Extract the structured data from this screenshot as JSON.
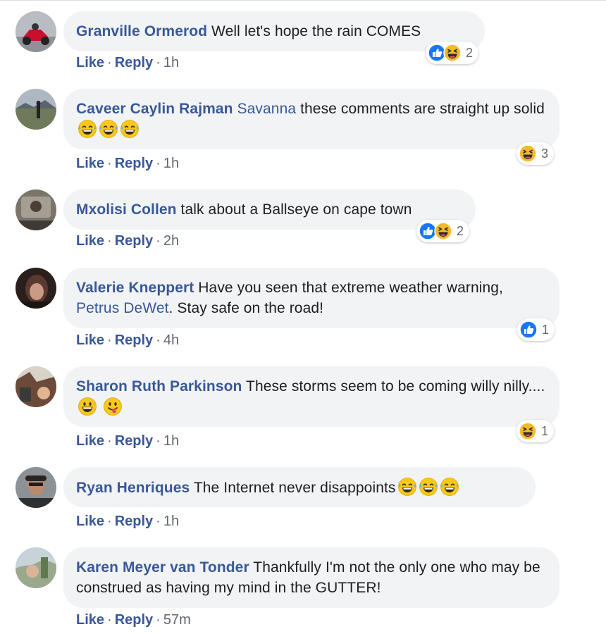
{
  "actions": {
    "like_label": "Like",
    "reply_label": "Reply",
    "separator": "·"
  },
  "colors": {
    "link": "#385898",
    "bubble": "#f2f3f5",
    "like_blue": "#1877f2",
    "haha_yellow": "#f7b928"
  },
  "comments": [
    {
      "author": "Granville Ormerod",
      "mention": "",
      "text": "Well let's hope the rain COMES",
      "text2": "",
      "time": "1h",
      "reaction_icons": [
        "like-icon",
        "haha-icon"
      ],
      "reaction_count": "2"
    },
    {
      "author": "Caveer Caylin Rajman",
      "mention": "Savanna",
      "text": "these comments are straight up solid",
      "text2": "",
      "time": "1h",
      "trailing_emojis": [
        "grinning-sweat-emoji",
        "grinning-sweat-emoji",
        "grinning-sweat-emoji"
      ],
      "reaction_icons": [
        "haha-icon"
      ],
      "reaction_count": "3"
    },
    {
      "author": "Mxolisi Collen",
      "mention": "",
      "text": "talk about a Ballseye on cape town",
      "text2": "",
      "time": "2h",
      "reaction_icons": [
        "like-icon",
        "haha-icon"
      ],
      "reaction_count": "2"
    },
    {
      "author": "Valerie Kneppert",
      "mention": "Petrus DeWet",
      "text": "Have you seen that extreme weather warning,",
      "text2": ". Stay safe on the road!",
      "time": "4h",
      "reaction_icons": [
        "like-icon"
      ],
      "reaction_count": "1"
    },
    {
      "author": "Sharon Ruth Parkinson",
      "mention": "",
      "text": "These storms seem to be coming willy nilly....",
      "text2": "",
      "time": "1h",
      "trailing_emojis": [
        "grinning-emoji",
        "tongue-emoji"
      ],
      "reaction_icons": [
        "haha-icon"
      ],
      "reaction_count": "1"
    },
    {
      "author": "Ryan Henriques",
      "mention": "",
      "text": "The Internet never disappoints",
      "text2": "",
      "time": "1h",
      "trailing_emojis": [
        "grinning-sweat-emoji",
        "grinning-sweat-emoji",
        "grinning-sweat-emoji"
      ]
    },
    {
      "author": "Karen Meyer van Tonder",
      "mention": "",
      "text": "Thankfully I'm not the only one who may be construed as having my mind in the GUTTER!",
      "text2": "",
      "time": "57m"
    }
  ]
}
